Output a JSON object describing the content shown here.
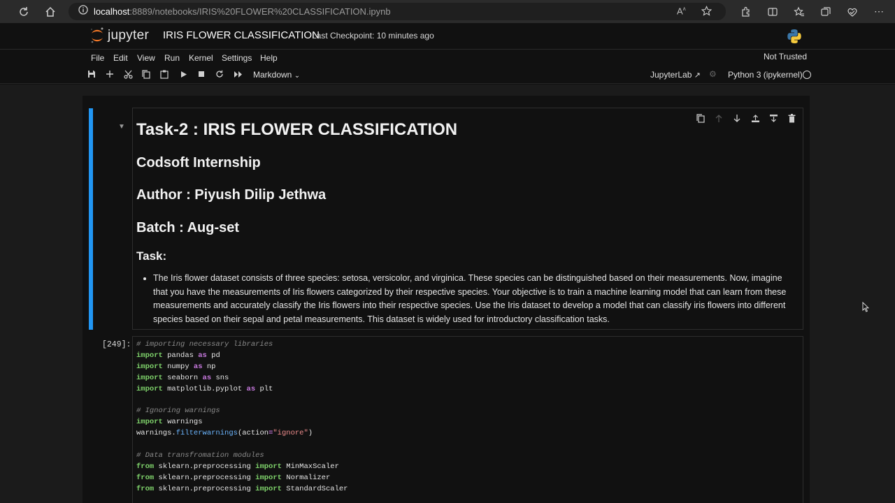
{
  "browser": {
    "url_host": "localhost",
    "url_path": ":8889/notebooks/IRIS%20FLOWER%20CLASSIFICATION.ipynb"
  },
  "header": {
    "logo_text": "jupyter",
    "notebook_title": "IRIS FLOWER CLASSIFICATION",
    "checkpoint": "Last Checkpoint: 10 minutes ago"
  },
  "menu": {
    "items": [
      "File",
      "Edit",
      "View",
      "Run",
      "Kernel",
      "Settings",
      "Help"
    ],
    "trust": "Not Trusted"
  },
  "toolbar": {
    "cell_type": "Markdown",
    "jupyterlab_link": "JupyterLab",
    "kernel": "Python 3 (ipykernel)"
  },
  "markdown_cell": {
    "h1": "Task-2 : IRIS FLOWER CLASSIFICATION",
    "h2_internship": "Codsoft Internship",
    "h2_author": "Author : Piyush Dilip Jethwa",
    "h2_batch": "Batch : Aug-set",
    "h3_task": "Task:",
    "task_text": "The Iris flower dataset consists of three species: setosa, versicolor, and virginica. These species can be distinguished based on their measurements. Now, imagine that you have the measurements of Iris flowers categorized by their respective species. Your objective is to train a machine learning model that can learn from these measurements and accurately classify the Iris flowers into their respective species. Use the Iris dataset to develop a model that can classify iris flowers into different species based on their sepal and petal measurements. This dataset is widely used for introductory classification tasks."
  },
  "code_cell": {
    "prompt": "[249]:",
    "lines": [
      "# importing necessary libraries",
      "import pandas as pd",
      "import numpy as np",
      "import seaborn as sns",
      "import matplotlib.pyplot as plt",
      "",
      "# Ignoring warnings",
      "import warnings",
      "warnings.filterwarnings(action=\"ignore\")",
      "",
      "# Data transfromation modules",
      "from sklearn.preprocessing import MinMaxScaler",
      "from sklearn.preprocessing import Normalizer",
      "from sklearn.preprocessing import StandardScaler"
    ]
  },
  "colors": {
    "active_cell": "#2196f3",
    "comment": "#8a8a8a",
    "keyword": "#7fd36b",
    "string": "#f08d8d",
    "operator": "#c678dd"
  }
}
